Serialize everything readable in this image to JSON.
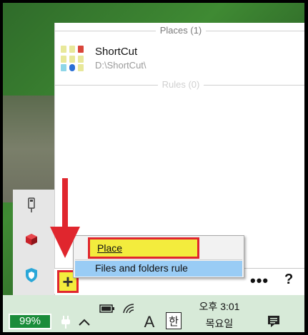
{
  "places_header": "Places (1)",
  "rules_header": "Rules (0)",
  "place": {
    "name": "ShortCut",
    "path": "D:\\ShortCut\\"
  },
  "add_button_label": "+",
  "more_button_label": "•••",
  "help_button_label": "?",
  "add_menu": {
    "place_label": "Place",
    "files_rule_label": "Files and folders rule"
  },
  "taskbar": {
    "battery": "99%",
    "input_lang": "A",
    "ime_mode": "한",
    "time": "오후 3:01",
    "weekday": "목요일"
  },
  "colors": {
    "highlight_yellow": "#f3ec3d",
    "annotation_red": "#e0262e",
    "menu_selection": "#99ccf5",
    "battery_green": "#1a8c3a",
    "taskbar_bg": "#d7ead8"
  }
}
